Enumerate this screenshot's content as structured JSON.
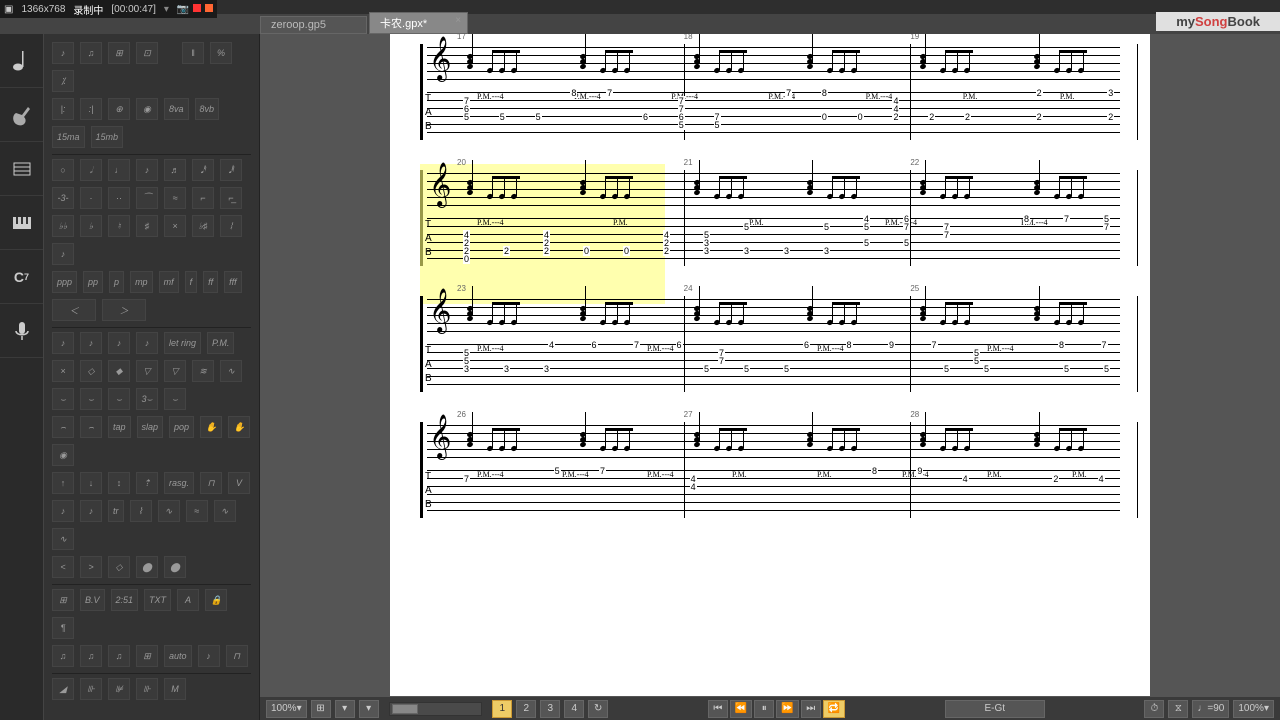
{
  "recording": {
    "resolution": "1366x768",
    "status": "录制中",
    "time": "[00:00:47]"
  },
  "tabs": [
    {
      "name": "zeroop.gp5",
      "active": false
    },
    {
      "name": "卡农.gpx*",
      "active": true
    }
  ],
  "songbook": {
    "prefix": "my",
    "mid": "Song",
    "suffix": "Book"
  },
  "sidebar_items": [
    "note",
    "guitar",
    "fretboard",
    "piano",
    "chord",
    "mic"
  ],
  "palette": {
    "dynamics": [
      "ppp",
      "pp",
      "p",
      "mp",
      "mf",
      "f",
      "ff",
      "fff"
    ],
    "techniques": [
      "let ring",
      "P.M.",
      "tap",
      "slap",
      "pop",
      "rasg.",
      "tr"
    ],
    "ottava": [
      "8va",
      "8vb",
      "15ma",
      "15mb"
    ],
    "misc": [
      "B.V",
      "2:51",
      "TXT",
      "auto"
    ]
  },
  "bottom": {
    "zoom_left": "100%",
    "zoom_right": "100%",
    "counts": [
      "1",
      "2",
      "3",
      "4"
    ],
    "active_count": "1",
    "track_name": "E-Gt",
    "tempo": "90",
    "tempo_prefix": "♩="
  },
  "score": {
    "systems": [
      {
        "measures": [
          17,
          18,
          19
        ],
        "highlight": false,
        "pm": [
          "P.M.---4",
          "P.M.---4",
          "P.M.---4",
          "P.M.---4",
          "P.M.---4",
          "P.M.",
          "P.M."
        ],
        "tab_rows": [
          [
            "",
            "",
            "",
            "8",
            "7",
            "",
            "",
            "",
            "",
            "7",
            "8",
            "",
            "",
            "",
            "",
            "",
            "2",
            "",
            "3"
          ],
          [
            "7",
            "",
            "",
            "",
            "",
            "",
            "7",
            "",
            "",
            "",
            "",
            "",
            "4",
            "",
            "",
            "",
            "",
            "",
            ""
          ],
          [
            "6",
            "",
            "",
            "",
            "",
            "",
            "7",
            "",
            "",
            "",
            "",
            "",
            "4",
            "",
            "",
            "",
            "",
            "",
            ""
          ],
          [
            "5",
            "5",
            "5",
            "",
            "",
            "6",
            "6",
            "7",
            "",
            "",
            "0",
            "0",
            "2",
            "2",
            "2",
            "",
            "2",
            "",
            "2"
          ],
          [
            "",
            "",
            "",
            "",
            "",
            "",
            "5",
            "5",
            "",
            "",
            "",
            "",
            "",
            "",
            "",
            "",
            "",
            "",
            ""
          ]
        ]
      },
      {
        "measures": [
          20,
          21,
          22
        ],
        "highlight": true,
        "highlight_range": [
          0,
          0.35
        ],
        "pm": [
          "P.M.---4",
          "P.M.",
          "P.M.",
          "P.M.-----4",
          "P.M.---4"
        ],
        "tab_rows": [
          [
            "",
            "",
            "",
            "",
            "",
            "",
            "",
            "",
            "",
            "",
            "4",
            "6",
            "",
            "",
            "8",
            "7",
            "5"
          ],
          [
            "",
            "",
            "",
            "",
            "",
            "",
            "",
            "5",
            "",
            "5",
            "5",
            "7",
            "7",
            "",
            "",
            "",
            "7"
          ],
          [
            "4",
            "",
            "4",
            "",
            "",
            "4",
            "5",
            "",
            "",
            "",
            "",
            "",
            "7",
            "",
            "",
            "",
            ""
          ],
          [
            "2",
            "",
            "2",
            "",
            "",
            "2",
            "3",
            "",
            "",
            "",
            "5",
            "5",
            "",
            "",
            "",
            "",
            ""
          ],
          [
            "2",
            "2",
            "2",
            "0",
            "0",
            "2",
            "3",
            "3",
            "3",
            "3",
            "",
            "",
            "",
            "",
            "",
            "",
            ""
          ],
          [
            "0",
            "",
            "",
            "",
            "",
            "",
            "",
            "",
            "",
            "",
            "",
            "",
            "",
            "",
            "",
            "",
            ""
          ]
        ]
      },
      {
        "measures": [
          23,
          24,
          25
        ],
        "highlight": false,
        "pm": [
          "P.M.---4",
          "P.M.---4",
          "P.M.---4",
          "P.M.---4"
        ],
        "tab_rows": [
          [
            "",
            "",
            "4",
            "6",
            "7",
            "6",
            "",
            "",
            "6",
            "8",
            "9",
            "7",
            "",
            "",
            "8",
            "7"
          ],
          [
            "5",
            "",
            "",
            "",
            "",
            "",
            "7",
            "",
            "",
            "",
            "",
            "",
            "5",
            "",
            "",
            ""
          ],
          [
            "5",
            "",
            "",
            "",
            "",
            "",
            "7",
            "",
            "",
            "",
            "",
            "",
            "5",
            "",
            "",
            ""
          ],
          [
            "3",
            "3",
            "3",
            "",
            "",
            "",
            "5",
            "5",
            "5",
            "",
            "",
            "",
            "5",
            "5",
            "",
            "5",
            "5"
          ]
        ]
      },
      {
        "measures": [
          26,
          27,
          28
        ],
        "highlight": false,
        "pm": [
          "P.M.---4",
          "P.M.---4",
          "P.M.---4",
          "P.M.",
          "P.M.",
          "P.M.---4",
          "P.M.",
          "P.M."
        ],
        "tab_rows": [
          [
            "",
            "",
            "5",
            "7",
            "",
            "",
            "",
            "",
            "",
            "8",
            "9",
            "",
            "",
            "",
            ""
          ],
          [
            "7",
            "",
            "",
            "",
            "",
            "4",
            "",
            "",
            "",
            "",
            "",
            "4",
            "",
            "2",
            "4"
          ],
          [
            "",
            "",
            "",
            "",
            "",
            "4",
            "",
            "",
            "",
            "",
            "",
            "",
            "",
            "",
            ""
          ]
        ]
      }
    ]
  }
}
